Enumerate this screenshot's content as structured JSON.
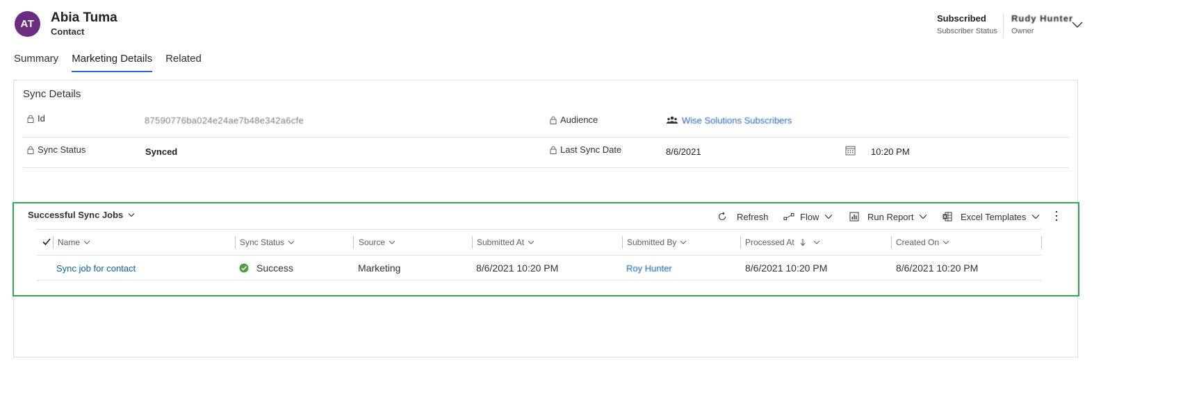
{
  "header": {
    "avatar_initials": "AT",
    "avatar_color": "#6b2d80",
    "record_name": "Abia Tuma",
    "record_type": "Contact",
    "fields": [
      {
        "value": "Subscribed",
        "label": "Subscriber Status"
      },
      {
        "value": "Rudy Hunter",
        "label": "Owner"
      }
    ]
  },
  "tabs": [
    {
      "label": "Summary",
      "active": false
    },
    {
      "label": "Marketing Details",
      "active": true
    },
    {
      "label": "Related",
      "active": false
    }
  ],
  "sync_details": {
    "title": "Sync Details",
    "id_label": "Id",
    "id_value": "87590776ba024e24ae7b48e342a6cfe",
    "audience_label": "Audience",
    "audience_value": "Wise Solutions Subscribers",
    "sync_status_label": "Sync Status",
    "sync_status_value": "Synced",
    "last_sync_label": "Last Sync Date",
    "last_sync_date": "8/6/2021",
    "last_sync_time": "10:20 PM"
  },
  "subgrid": {
    "title": "Successful Sync Jobs",
    "highlight_color": "#2fa84f",
    "commands": [
      {
        "label": "Refresh",
        "icon": "refresh-icon"
      },
      {
        "label": "Flow",
        "icon": "flow-icon"
      },
      {
        "label": "Run Report",
        "icon": "report-icon"
      },
      {
        "label": "Excel Templates",
        "icon": "excel-icon"
      }
    ],
    "columns": [
      "Name",
      "Sync Status",
      "Source",
      "Submitted At",
      "Submitted By",
      "Processed At",
      "Created On"
    ],
    "rows": [
      {
        "name": "Sync job for contact",
        "sync_status": "Success",
        "source": "Marketing",
        "submitted_at": "8/6/2021 10:20 PM",
        "submitted_by": "Roy Hunter",
        "processed_at": "8/6/2021 10:20 PM",
        "created_on": "8/6/2021 10:20 PM"
      }
    ]
  }
}
